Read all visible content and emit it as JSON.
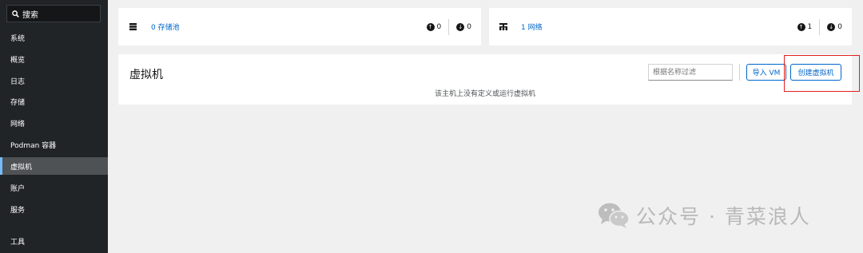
{
  "sidebar": {
    "search_label": "搜索",
    "items": [
      {
        "label": "系统"
      },
      {
        "label": "概览"
      },
      {
        "label": "日志"
      },
      {
        "label": "存储"
      },
      {
        "label": "网络"
      },
      {
        "label": "Podman 容器"
      },
      {
        "label": "虚拟机"
      },
      {
        "label": "账户"
      },
      {
        "label": "服务"
      },
      {
        "label": "工具"
      }
    ],
    "active": "虚拟机"
  },
  "storage_card": {
    "link": "0 存储池",
    "active_count": "0",
    "inactive_count": "0"
  },
  "network_card": {
    "link": "1 网络",
    "active_count": "1",
    "inactive_count": "0"
  },
  "vm_panel": {
    "title": "虚拟机",
    "filter_placeholder": "根据名称过滤",
    "import_label": "导入 VM",
    "create_label": "创建虚拟机",
    "empty_text": "该主机上没有定义或运行虚拟机"
  },
  "watermark": {
    "text": "公众号 · 青菜浪人"
  },
  "colors": {
    "sidebar_bg": "#212427",
    "accent": "#0066cc",
    "highlight": "#e02020"
  }
}
